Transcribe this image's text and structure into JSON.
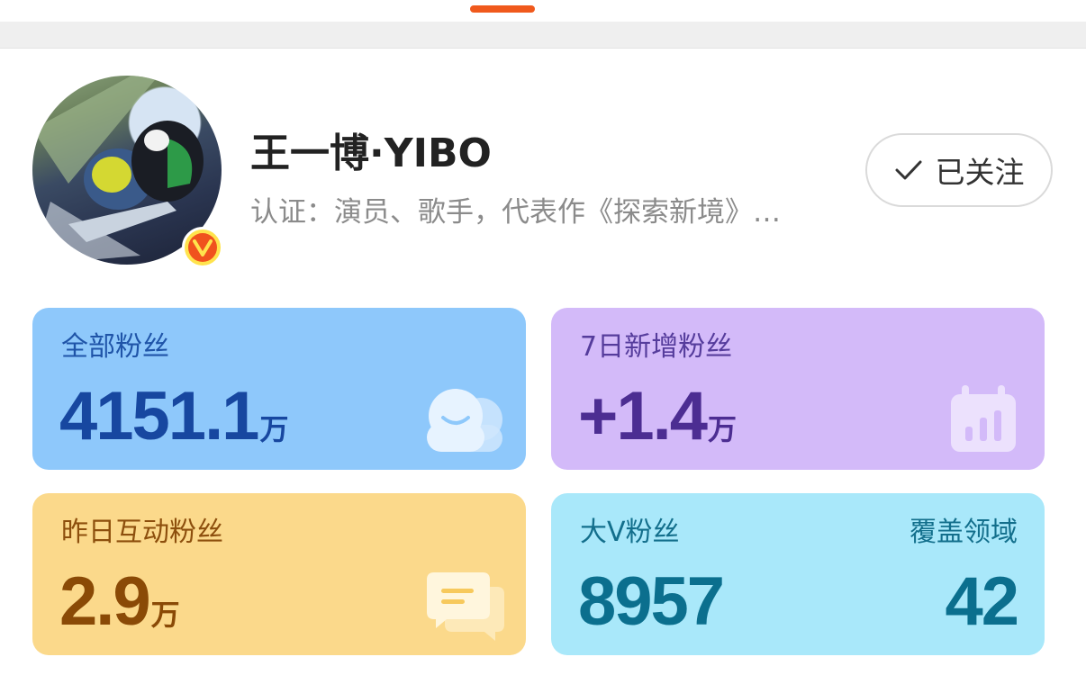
{
  "colors": {
    "accent": "#f0591c",
    "card_total_bg": "#8ec8fb",
    "card_new7_bg": "#d3baf9",
    "card_interact_bg": "#fbd98b",
    "card_bigv_bg": "#a9e8fa"
  },
  "profile": {
    "name": "王一博·YIBO",
    "verification": "认证：演员、歌手，代表作《探索新境》…",
    "avatar_icon": "avatar-photo",
    "verified_icon": "verified-v-badge-icon",
    "follow_label": "已关注",
    "follow_icon": "checkmark-icon"
  },
  "stats": {
    "total_fans": {
      "label": "全部粉丝",
      "value": "4151.1",
      "unit": "万",
      "icon": "fans-faces-icon"
    },
    "new_fans_7d": {
      "label": "7日新增粉丝",
      "value": "+1.4",
      "unit": "万",
      "icon": "calendar-chart-icon"
    },
    "interact_fans_yesterday": {
      "label": "昨日互动粉丝",
      "value": "2.9",
      "unit": "万",
      "icon": "chat-bubbles-icon"
    },
    "big_v_fans": {
      "label": "大V粉丝",
      "value": "8957",
      "coverage_label": "覆盖领域",
      "coverage_value": "42"
    }
  }
}
